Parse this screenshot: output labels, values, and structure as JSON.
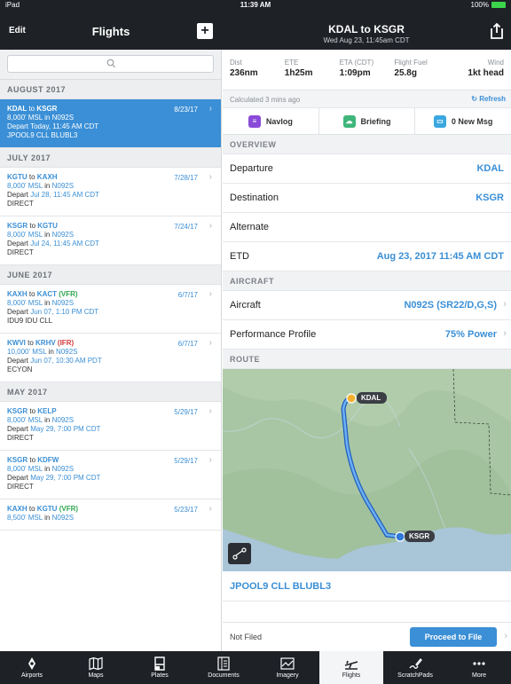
{
  "status_bar": {
    "device": "iPad",
    "time": "11:39 AM",
    "battery": "100%"
  },
  "left_header": {
    "edit_label": "Edit",
    "title": "Flights",
    "add_label": "+"
  },
  "right_header": {
    "title": "KDAL to KSGR",
    "subtitle": "Wed Aug 23, 11:45am CDT"
  },
  "sections": [
    {
      "header": "AUGUST 2017",
      "flights": [
        {
          "from": "KDAL",
          "to": "KSGR",
          "to_rule": "",
          "alt": "8,000' MSL",
          "tail": "N092S",
          "depart": "Today, 11:45 AM CDT",
          "route": "JPOOL9 CLL BLUBL3",
          "date": "8/23/17",
          "selected": true
        }
      ]
    },
    {
      "header": "JULY 2017",
      "flights": [
        {
          "from": "KGTU",
          "to": "KAXH",
          "to_rule": "",
          "alt": "8,000' MSL",
          "tail": "N092S",
          "depart": "Jul 28, 11:45 AM CDT",
          "route": "DIRECT",
          "date": "7/28/17"
        },
        {
          "from": "KSGR",
          "to": "KGTU",
          "to_rule": "",
          "alt": "8,000' MSL",
          "tail": "N092S",
          "depart": "Jul 24, 11:45 AM CDT",
          "route": "DIRECT",
          "date": "7/24/17"
        }
      ]
    },
    {
      "header": "JUNE 2017",
      "flights": [
        {
          "from": "KAXH",
          "to": "KACT",
          "to_rule": "(VFR)",
          "rule_class": "vfr",
          "alt": "8,000' MSL",
          "tail": "N092S",
          "depart": "Jun 07, 1:10 PM CDT",
          "route": "IDU9 IDU CLL",
          "date": "6/7/17"
        },
        {
          "from": "KWVI",
          "to": "KRHV",
          "to_rule": "(IFR)",
          "rule_class": "ifr",
          "alt": "10,000' MSL",
          "tail": "N092S",
          "depart": "Jun 07, 10:30 AM PDT",
          "route": "ECYON",
          "date": "6/7/17"
        }
      ]
    },
    {
      "header": "MAY 2017",
      "flights": [
        {
          "from": "KSGR",
          "to": "KELP",
          "to_rule": "",
          "alt": "8,000' MSL",
          "tail": "N092S",
          "depart": "May 29, 7:00 PM CDT",
          "route": "DIRECT",
          "date": "5/29/17"
        },
        {
          "from": "KSGR",
          "to": "KDFW",
          "to_rule": "",
          "alt": "8,000' MSL",
          "tail": "N092S",
          "depart": "May 29, 7:00 PM CDT",
          "route": "DIRECT",
          "date": "5/29/17"
        },
        {
          "from": "KAXH",
          "to": "KGTU",
          "to_rule": "(VFR)",
          "rule_class": "vfr",
          "alt": "8,500' MSL",
          "tail": "N092S",
          "depart": "",
          "route": "",
          "date": "5/23/17"
        }
      ]
    }
  ],
  "stats": [
    {
      "label": "Dist",
      "value": "236nm"
    },
    {
      "label": "ETE",
      "value": "1h25m"
    },
    {
      "label": "ETA (CDT)",
      "value": "1:09pm"
    },
    {
      "label": "Flight Fuel",
      "value": "25.8g"
    },
    {
      "label": "Wind",
      "value": "1kt head"
    }
  ],
  "calc": {
    "text": "Calculated 3 mins ago",
    "refresh": "Refresh"
  },
  "actions": {
    "navlog": "Navlog",
    "briefing": "Briefing",
    "messages": "0 New Msg"
  },
  "overview": {
    "header": "OVERVIEW",
    "departure_label": "Departure",
    "departure": "KDAL",
    "destination_label": "Destination",
    "destination": "KSGR",
    "alternate_label": "Alternate",
    "alternate": "",
    "etd_label": "ETD",
    "etd": "Aug 23, 2017 11:45 AM CDT"
  },
  "aircraft": {
    "header": "AIRCRAFT",
    "aircraft_label": "Aircraft",
    "aircraft": "N092S (SR22/D,G,S)",
    "profile_label": "Performance Profile",
    "profile": "75% Power"
  },
  "route": {
    "header": "ROUTE",
    "origin_label": "KDAL",
    "dest_label": "KSGR",
    "route_string": "JPOOL9 CLL BLUBL3"
  },
  "filing": {
    "status": "Not Filed",
    "button": "Proceed to File"
  },
  "tabs": [
    "Airports",
    "Maps",
    "Plates",
    "Documents",
    "Imagery",
    "Flights",
    "ScratchPads",
    "More"
  ],
  "colors": {
    "accent": "#3a8fd6",
    "dark": "#1e2126",
    "vfr": "#2fa84f",
    "ifr": "#d43a3a"
  }
}
